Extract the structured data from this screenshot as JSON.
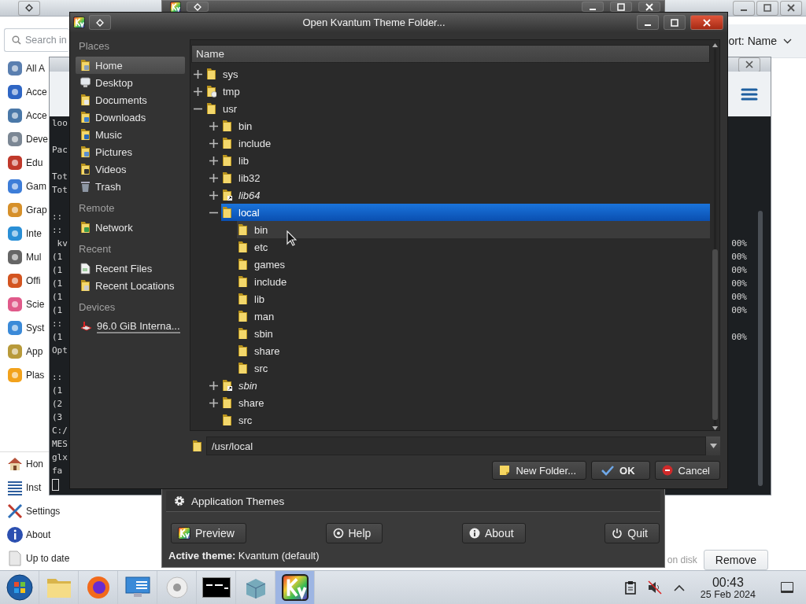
{
  "store_window": {
    "sort": {
      "label": "ort: Name"
    },
    "status_text": "on disk",
    "remove_button": "Remove"
  },
  "launcher": {
    "search": {
      "placeholder": "Search in"
    },
    "categories": [
      {
        "label": "All A"
      },
      {
        "label": "Acce"
      },
      {
        "label": "Acce"
      },
      {
        "label": "Deve"
      },
      {
        "label": "Edu"
      },
      {
        "label": "Gam"
      },
      {
        "label": "Grap"
      },
      {
        "label": "Inte"
      },
      {
        "label": "Mul"
      },
      {
        "label": "Offi"
      },
      {
        "label": "Scie"
      },
      {
        "label": "Syst"
      },
      {
        "label": "App"
      },
      {
        "label": "Plas"
      }
    ],
    "actions": [
      {
        "label": "Hon",
        "kind": "home"
      },
      {
        "label": "Inst",
        "kind": "list"
      },
      {
        "label": "Settings",
        "kind": "tools"
      },
      {
        "label": "About",
        "kind": "info"
      },
      {
        "label": "Up to date",
        "kind": "page"
      }
    ]
  },
  "terminal": {
    "lines": [
      {
        "kind": "text",
        "text": "loo"
      },
      {
        "kind": "blank"
      },
      {
        "kind": "text",
        "text": "Pac"
      },
      {
        "kind": "blank"
      },
      {
        "kind": "text",
        "text": "Tot"
      },
      {
        "kind": "text",
        "text": "Tot"
      },
      {
        "kind": "blank"
      },
      {
        "kind": "text",
        "text": "::"
      },
      {
        "kind": "text",
        "text": "::"
      },
      {
        "kind": "text",
        "text": " kv",
        "tail": "00%"
      },
      {
        "kind": "text",
        "text": "(1",
        "tail": "00%"
      },
      {
        "kind": "text",
        "text": "(1",
        "tail": "00%"
      },
      {
        "kind": "text",
        "text": "(1",
        "tail": "00%"
      },
      {
        "kind": "text",
        "text": "(1",
        "tail": "00%"
      },
      {
        "kind": "text",
        "text": "(1",
        "tail": "00%"
      },
      {
        "kind": "text",
        "text": "::"
      },
      {
        "kind": "text",
        "text": "(1",
        "tail": "00%"
      },
      {
        "kind": "text",
        "text": "Opt"
      },
      {
        "kind": "blank"
      },
      {
        "kind": "text",
        "text": "::"
      },
      {
        "kind": "text",
        "text": "(1"
      },
      {
        "kind": "text",
        "text": "(2"
      },
      {
        "kind": "text",
        "text": "(3"
      },
      {
        "kind": "text",
        "text": "C:/"
      },
      {
        "kind": "text",
        "text": "MES"
      },
      {
        "kind": "text",
        "text": "glx"
      },
      {
        "kind": "text",
        "text": "fa"
      },
      {
        "kind": "cursor"
      }
    ]
  },
  "kvantum_manager": {
    "tab": "Application Themes",
    "buttons": [
      {
        "label": "Preview",
        "kind": "preview"
      },
      {
        "label": "Help",
        "kind": "help"
      },
      {
        "label": "About",
        "kind": "about"
      },
      {
        "label": "Quit",
        "kind": "quit"
      }
    ],
    "active_theme": "**Active theme:** Kvantum (default)"
  },
  "dialog": {
    "title": "Open Kvantum Theme Folder...",
    "places": [
      {
        "title": "Places",
        "items": [
          {
            "label": "Home",
            "kind": "home",
            "selected": true
          },
          {
            "label": "Desktop",
            "kind": "desktop",
            "selected": false
          },
          {
            "label": "Documents",
            "kind": "documents",
            "selected": false
          },
          {
            "label": "Downloads",
            "kind": "downloads",
            "selected": false
          },
          {
            "label": "Music",
            "kind": "music",
            "selected": false
          },
          {
            "label": "Pictures",
            "kind": "pictures",
            "selected": false
          },
          {
            "label": "Videos",
            "kind": "videos",
            "selected": false
          },
          {
            "label": "Trash",
            "kind": "trash",
            "selected": false
          }
        ]
      },
      {
        "title": "Remote",
        "items": [
          {
            "label": "Network",
            "kind": "network",
            "selected": false
          }
        ]
      },
      {
        "title": "Recent",
        "items": [
          {
            "label": "Recent Files",
            "kind": "recent-files",
            "selected": false
          },
          {
            "label": "Recent Locations",
            "kind": "recent-locations",
            "selected": false
          }
        ]
      },
      {
        "title": "Devices",
        "items": [
          {
            "label": "96.0 GiB Interna...",
            "kind": "drive",
            "selected": false
          }
        ]
      }
    ],
    "tree": {
      "column": "Name",
      "nodes": [
        {
          "name": "sys",
          "kind": "folder",
          "expanded": false,
          "selected": false,
          "hovered": false
        },
        {
          "name": "tmp",
          "kind": "temp",
          "expanded": false,
          "selected": false,
          "hovered": false
        },
        {
          "name": "usr",
          "kind": "folder",
          "expanded": true,
          "selected": false,
          "hovered": false,
          "children": [
            {
              "name": "bin",
              "kind": "folder",
              "expanded": false,
              "selected": false,
              "hovered": false
            },
            {
              "name": "include",
              "kind": "folder",
              "expanded": false,
              "selected": false,
              "hovered": false
            },
            {
              "name": "lib",
              "kind": "folder",
              "expanded": false,
              "selected": false,
              "hovered": false
            },
            {
              "name": "lib32",
              "kind": "folder",
              "expanded": false,
              "selected": false,
              "hovered": false
            },
            {
              "name": "lib64",
              "kind": "link",
              "expanded": false,
              "selected": false,
              "hovered": false
            },
            {
              "name": "local",
              "kind": "folder",
              "expanded": true,
              "selected": true,
              "hovered": false,
              "children": [
                {
                  "name": "bin",
                  "kind": "folder",
                  "selected": false,
                  "hovered": true
                },
                {
                  "name": "etc",
                  "kind": "folder",
                  "selected": false,
                  "hovered": false
                },
                {
                  "name": "games",
                  "kind": "folder",
                  "selected": false,
                  "hovered": false
                },
                {
                  "name": "include",
                  "kind": "folder",
                  "selected": false,
                  "hovered": false
                },
                {
                  "name": "lib",
                  "kind": "folder",
                  "selected": false,
                  "hovered": false
                },
                {
                  "name": "man",
                  "kind": "folder",
                  "selected": false,
                  "hovered": false
                },
                {
                  "name": "sbin",
                  "kind": "folder",
                  "selected": false,
                  "hovered": false
                },
                {
                  "name": "share",
                  "kind": "folder",
                  "selected": false,
                  "hovered": false
                },
                {
                  "name": "src",
                  "kind": "folder",
                  "selected": false,
                  "hovered": false
                }
              ]
            },
            {
              "name": "sbin",
              "kind": "link",
              "expanded": false,
              "selected": false,
              "hovered": false
            },
            {
              "name": "share",
              "kind": "folder",
              "expanded": false,
              "selected": false,
              "hovered": false
            },
            {
              "name": "src",
              "kind": "folder",
              "selected": false,
              "hovered": false
            }
          ]
        }
      ]
    },
    "path": {
      "value": "/usr/local"
    },
    "buttons": [
      {
        "label": "New Folder...",
        "kind": "new-folder",
        "default": false
      },
      {
        "label": "OK",
        "kind": "ok",
        "default": true
      },
      {
        "label": "Cancel",
        "kind": "cancel",
        "default": false
      }
    ]
  },
  "taskbar": {
    "apps": [
      {
        "kind": "start",
        "active": false
      },
      {
        "kind": "files",
        "active": false
      },
      {
        "kind": "browser",
        "active": false
      },
      {
        "kind": "monitor",
        "active": false
      },
      {
        "kind": "disc",
        "active": false
      },
      {
        "kind": "terminal",
        "active": false
      },
      {
        "kind": "package",
        "active": false
      },
      {
        "kind": "kvantum",
        "active": true
      }
    ],
    "tray": [
      {
        "kind": "clipboard"
      },
      {
        "kind": "volume-muted"
      },
      {
        "kind": "expand"
      }
    ],
    "clock": {
      "time": "00:43",
      "date": "25 Feb 2024"
    }
  }
}
